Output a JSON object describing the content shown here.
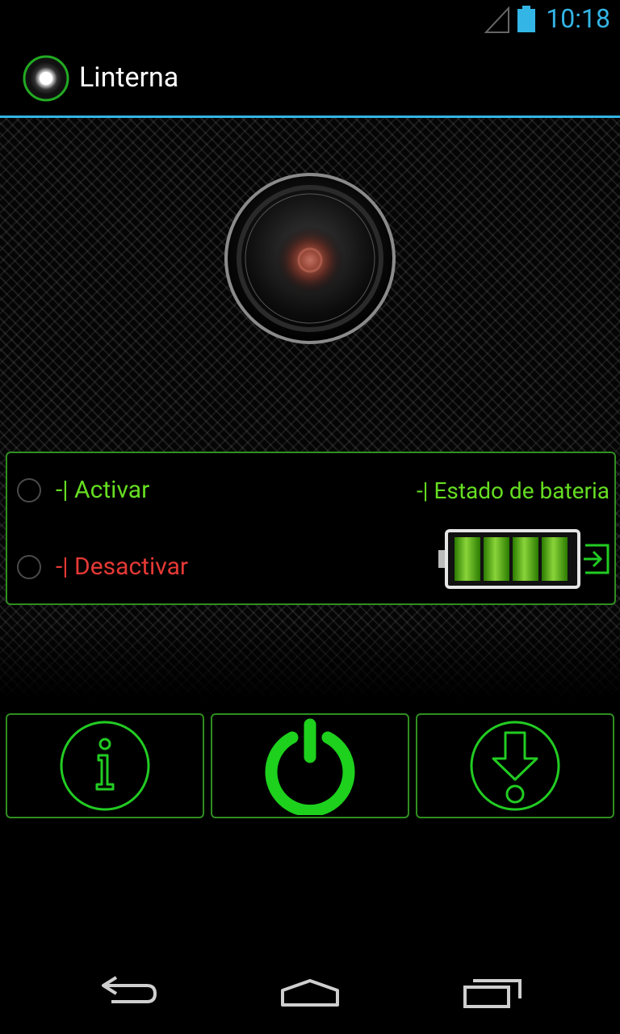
{
  "status_bar": {
    "time": "10:18",
    "icons": [
      "signal-icon",
      "battery-icon"
    ]
  },
  "action_bar": {
    "title": "Linterna",
    "icon": "flashlight-app-icon"
  },
  "controls": {
    "activar_label": "-| Activar",
    "desactivar_label": "-| Desactivar",
    "estado_label": "-| Estado de bateria",
    "battery_level": 1.0
  },
  "buttons": [
    "info-icon",
    "power-icon",
    "download-icon"
  ],
  "nav": [
    "back-icon",
    "home-icon",
    "recent-apps-icon"
  ],
  "colors": {
    "accent_blue": "#33b5e5",
    "green": "#22cc22",
    "label_green": "#66dd22",
    "label_red": "#e53935"
  }
}
